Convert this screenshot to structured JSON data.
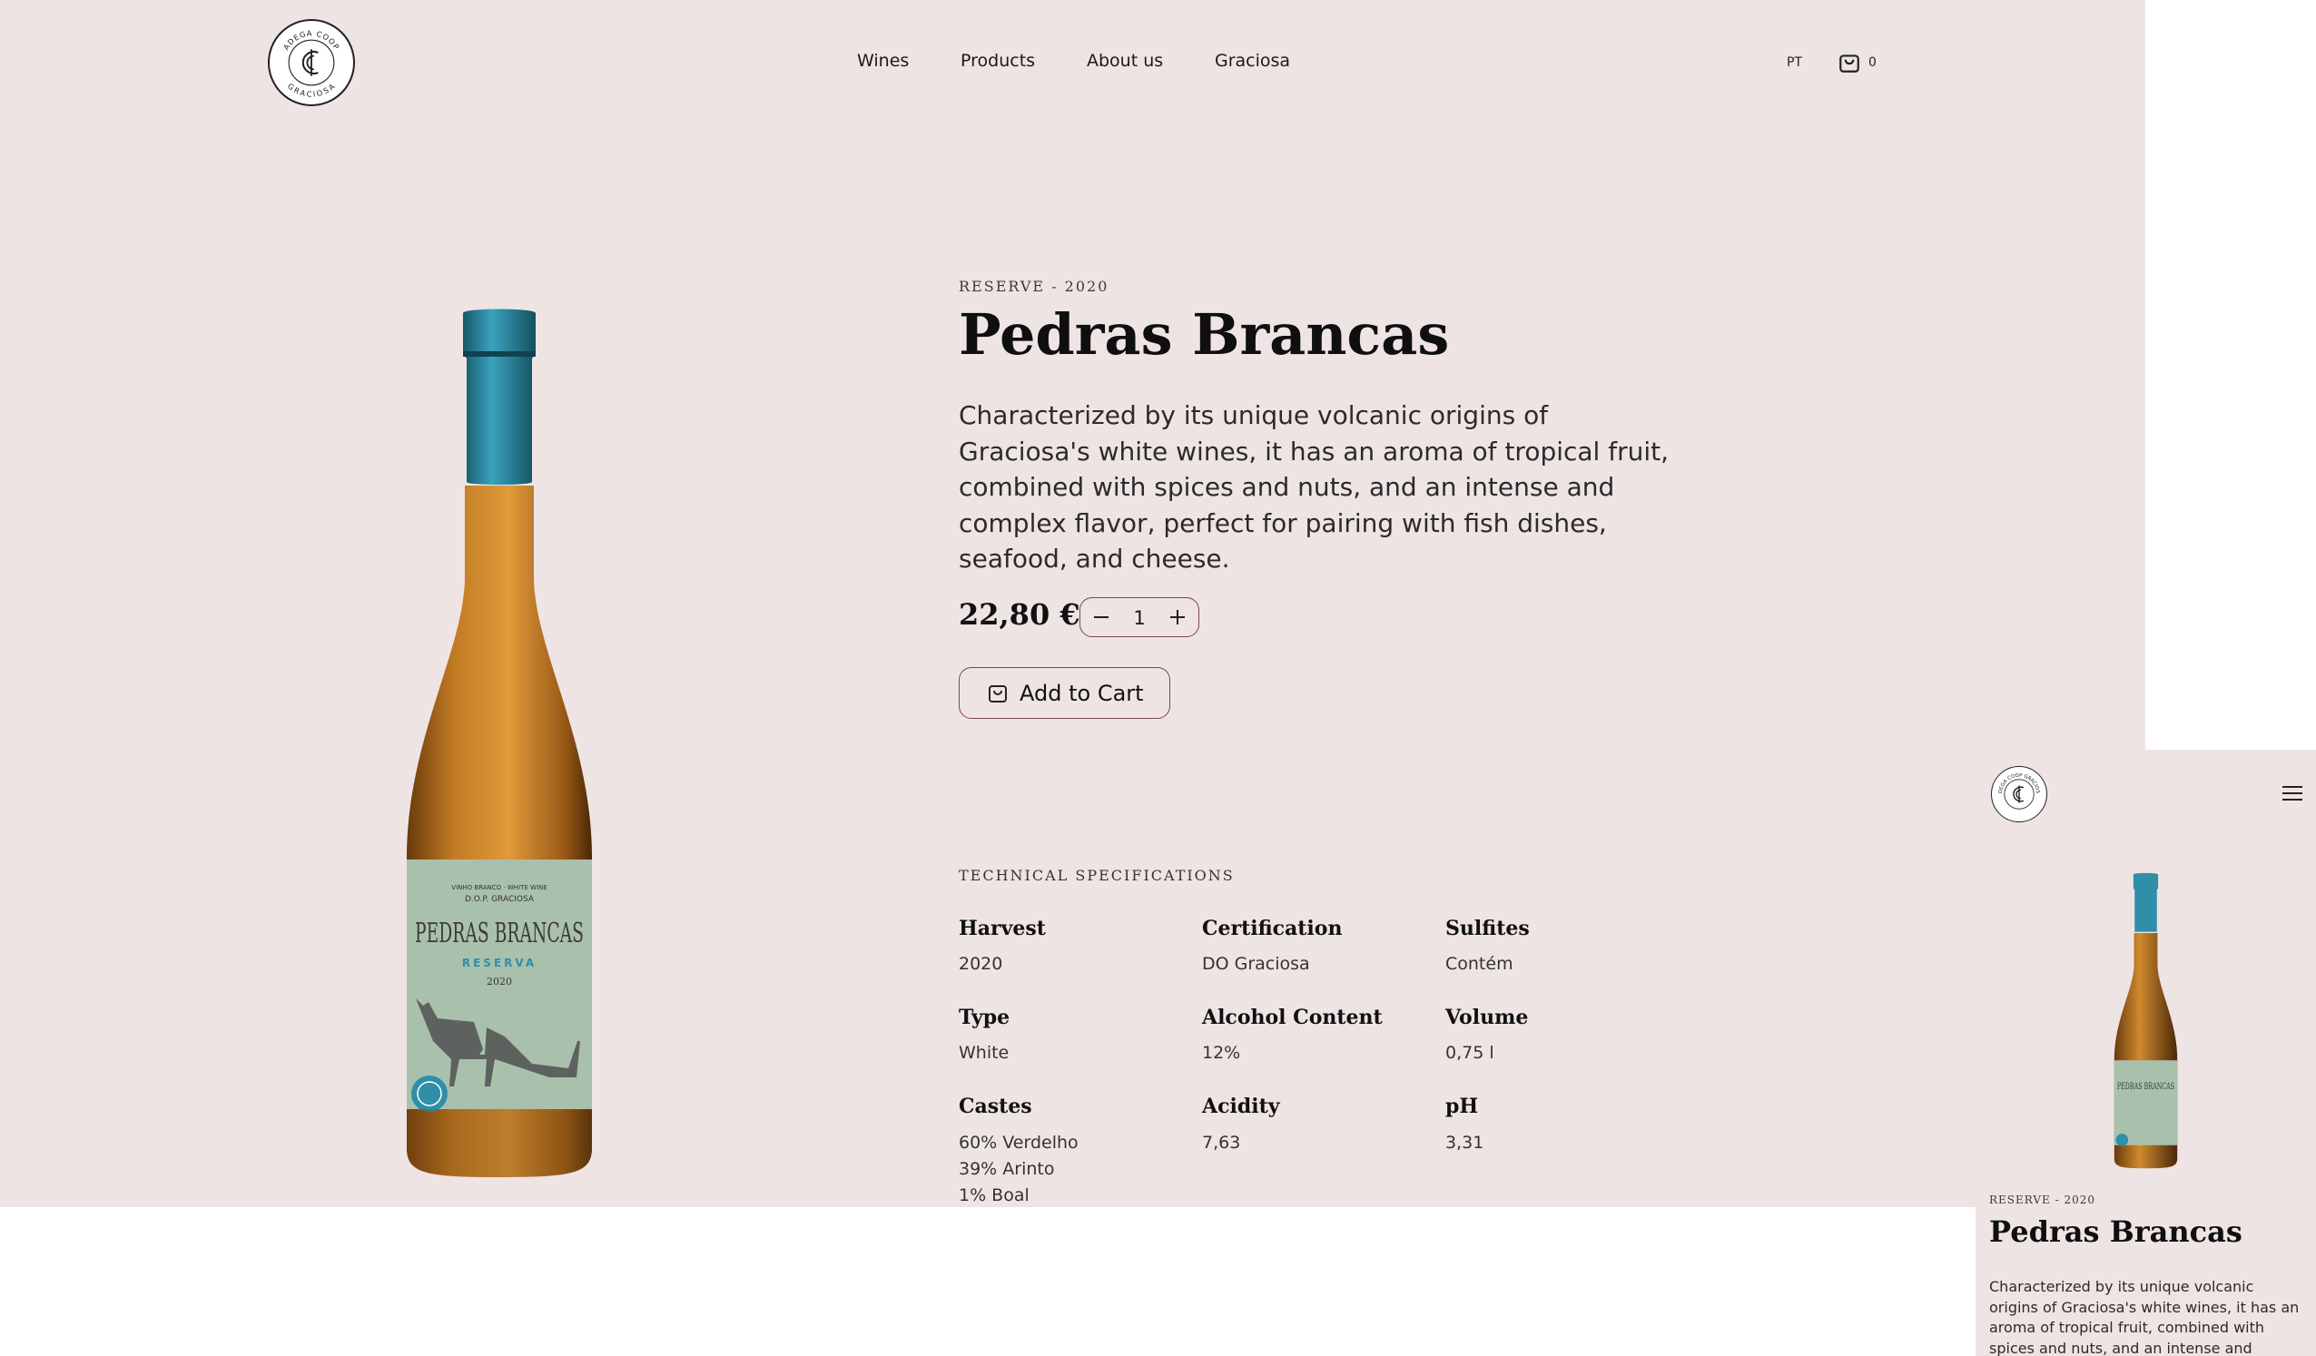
{
  "header": {
    "logo_text": "ADEGA COOP GRACIOSA",
    "nav": [
      "Wines",
      "Products",
      "About us",
      "Graciosa"
    ],
    "language": "PT",
    "cart_count": "0"
  },
  "product": {
    "kicker": "RESERVE - 2020",
    "name": "Pedras Brancas",
    "description": "Characterized by its unique volcanic origins of Graciosa's white wines, it has an aroma of tropical fruit, combined with spices and nuts, and an intense and complex flavor, perfect for pairing with fish dishes, seafood, and cheese.",
    "price": "22,80 €",
    "quantity": "1",
    "add_to_cart": "Add to Cart",
    "label": {
      "top": "VINHO BRANCO · WHITE WINE",
      "region": "D.O.P. GRACIOSA",
      "brand": "PEDRAS BRANCAS",
      "reserve": "RESERVA",
      "year": "2020"
    }
  },
  "specs": {
    "heading": "TECHNICAL SPECIFICATIONS",
    "items": [
      {
        "label": "Harvest",
        "value": "2020"
      },
      {
        "label": "Certification",
        "value": "DO Graciosa"
      },
      {
        "label": "Sulfites",
        "value": "Contém"
      },
      {
        "label": "Type",
        "value": "White"
      },
      {
        "label": "Alcohol Content",
        "value": "12%"
      },
      {
        "label": "Volume",
        "value": "0,75 l"
      },
      {
        "label": "Castes",
        "value": [
          "60% Verdelho",
          "39% Arinto",
          "1% Boal"
        ]
      },
      {
        "label": "Acidity",
        "value": "7,63"
      },
      {
        "label": "pH",
        "value": "3,31"
      }
    ]
  },
  "mobile": {
    "kicker": "RESERVE - 2020",
    "name": "Pedras Brancas",
    "description": "Characterized by its unique volcanic origins of Graciosa's white wines, it has an aroma of tropical fruit, combined with spices and nuts, and an intense and complex flavor, perfect for pairing with fish dishes, seafood, and cheese."
  },
  "colors": {
    "background": "#efe4e4",
    "button_border": "#7a4848",
    "bottle_capsule": "#2f8fa8",
    "bottle_glass": "#c47a22",
    "label": "#a9c0ad"
  }
}
